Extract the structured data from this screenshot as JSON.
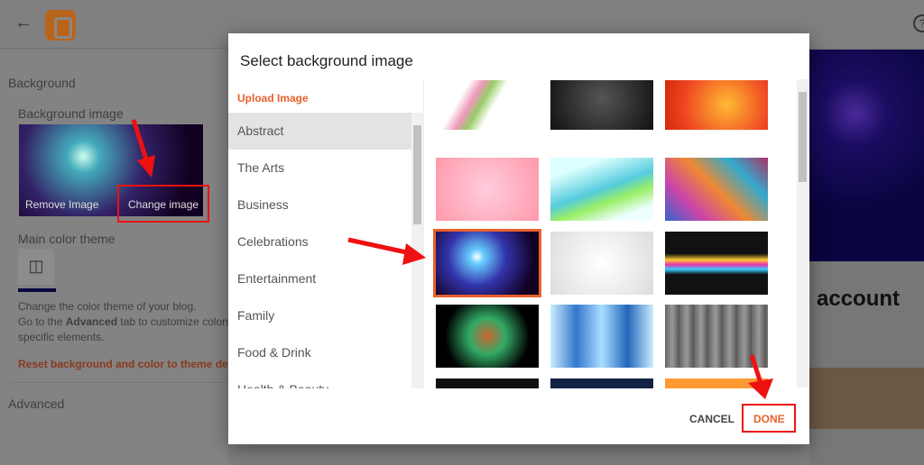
{
  "header": {
    "back_icon": "arrow-left",
    "logo": "blogger",
    "help_icon": "question-circle"
  },
  "left_panel": {
    "section": "Background",
    "background_image_label": "Background image",
    "remove_image": "Remove Image",
    "change_image": "Change image",
    "main_color_theme": "Main color theme",
    "theme_color": "#0a0640",
    "desc_line1": "Change the color theme of your blog.",
    "desc_line2_pre": "Go to the ",
    "desc_line2_bold": "Advanced",
    "desc_line2_post": " tab to customize colors",
    "desc_line3": "specific elements.",
    "reset_link": "Reset background and color to theme defau",
    "advanced": "Advanced"
  },
  "preview": {
    "heading": "account"
  },
  "dialog": {
    "title": "Select background image",
    "upload": "Upload Image",
    "categories": [
      "Abstract",
      "The Arts",
      "Business",
      "Celebrations",
      "Entertainment",
      "Family",
      "Food & Drink",
      "Health & Beauty"
    ],
    "selected_category": "Abstract",
    "selected_tile": "row 3, column 1",
    "cancel": "CANCEL",
    "done": "DONE",
    "accent": "#e8612c"
  }
}
